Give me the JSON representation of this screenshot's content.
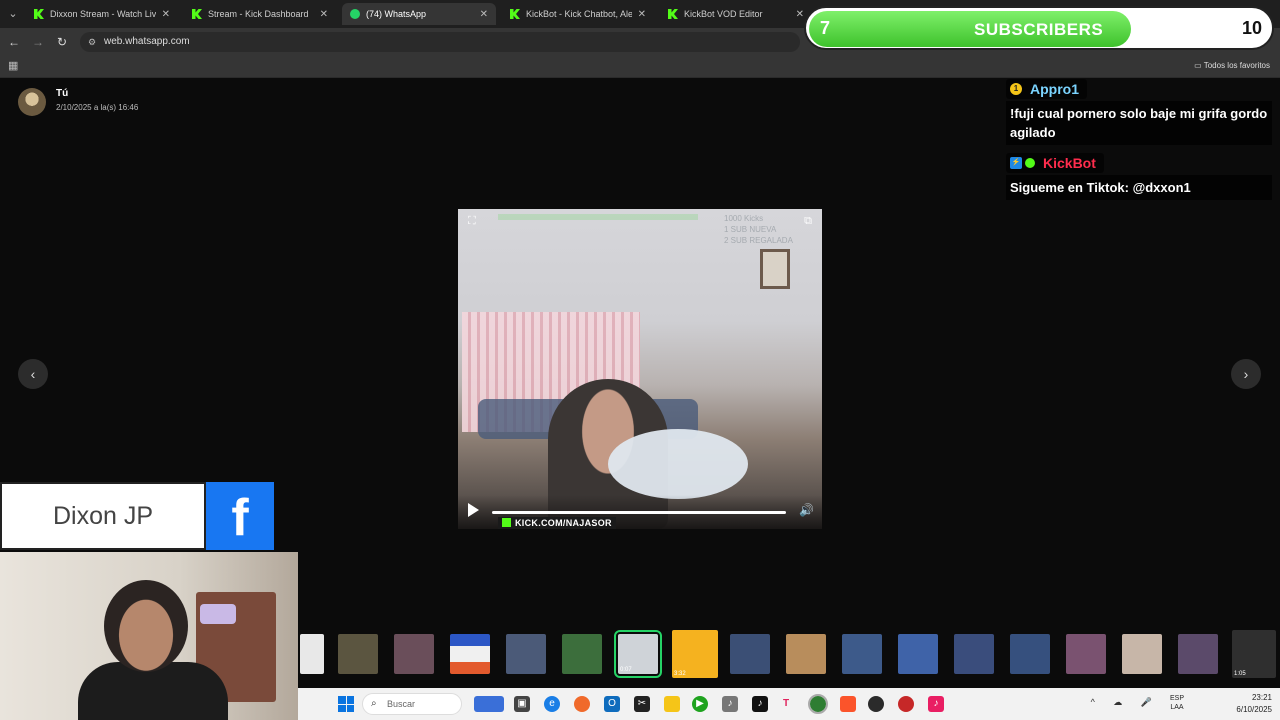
{
  "browser": {
    "tabs": [
      {
        "label": "Dixxon Stream - Watch Live on",
        "icon": "kick"
      },
      {
        "label": "Stream - Kick Dashboard",
        "icon": "kick"
      },
      {
        "label": "(74) WhatsApp",
        "icon": "whatsapp",
        "active": true
      },
      {
        "label": "KickBot - Kick Chatbot, Alerts, T",
        "icon": "kick"
      },
      {
        "label": "KickBot VOD Editor",
        "icon": "kick"
      }
    ],
    "url": "web.whatsapp.com",
    "bookmarks_folder": "Todos los favoritos"
  },
  "whatsapp": {
    "sender_name": "Tú",
    "sender_time": "2/10/2025 a la(s) 16:46",
    "video": {
      "overlay_lines": [
        "1000 Kicks",
        "1 SUB NUEVA",
        "2 SUB REGALADA"
      ],
      "watermark": "KICK.COM/NAJASOR"
    },
    "filmstrip_durations": [
      "0:07",
      "3:32",
      "1:05"
    ]
  },
  "overlay": {
    "sub_goal": {
      "current": "7",
      "label": "SUBSCRIBERS",
      "goal": "10",
      "progress": 0.7
    },
    "chat": [
      {
        "user": "Appro1",
        "user_color": "#7bd4ff",
        "badge": "1",
        "message": "!fuji cual pornero solo baje mi grifa gordo agilado"
      },
      {
        "user": "KickBot",
        "user_color": "#ff2d4d",
        "badge": "bot",
        "message": "Sigueme en Tiktok: @dxxon1"
      }
    ],
    "name_card": {
      "name": "Dixon JP",
      "social": "f"
    }
  },
  "taskbar": {
    "search_placeholder": "Buscar",
    "lang_top": "ESP",
    "lang_bottom": "LAA",
    "time": "23:21",
    "date": "6/10/2025"
  }
}
